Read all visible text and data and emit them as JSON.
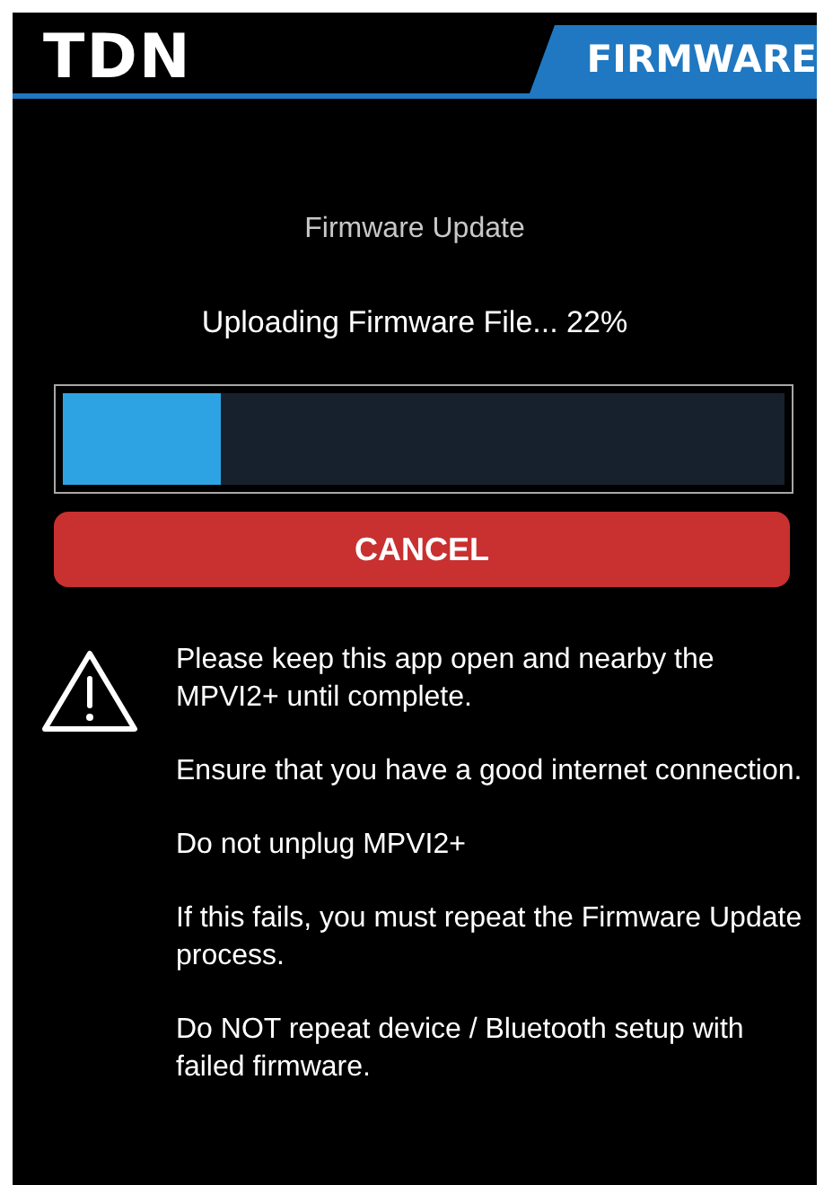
{
  "header": {
    "logo": "TDN",
    "section": "FIRMWARE"
  },
  "title": "Firmware Update",
  "status": "Uploading Firmware File... 22%",
  "progress": {
    "level": 0.22
  },
  "cancel_button": "CANCEL",
  "warnings": [
    "Please keep this app open and nearby the MPVI2+ until complete.",
    "Ensure that you have a good internet connection.",
    "Do not unplug MPVI2+",
    "If this fails, you must repeat the Firmware Update process.",
    "Do NOT repeat device / Bluetooth setup with failed firmware."
  ]
}
